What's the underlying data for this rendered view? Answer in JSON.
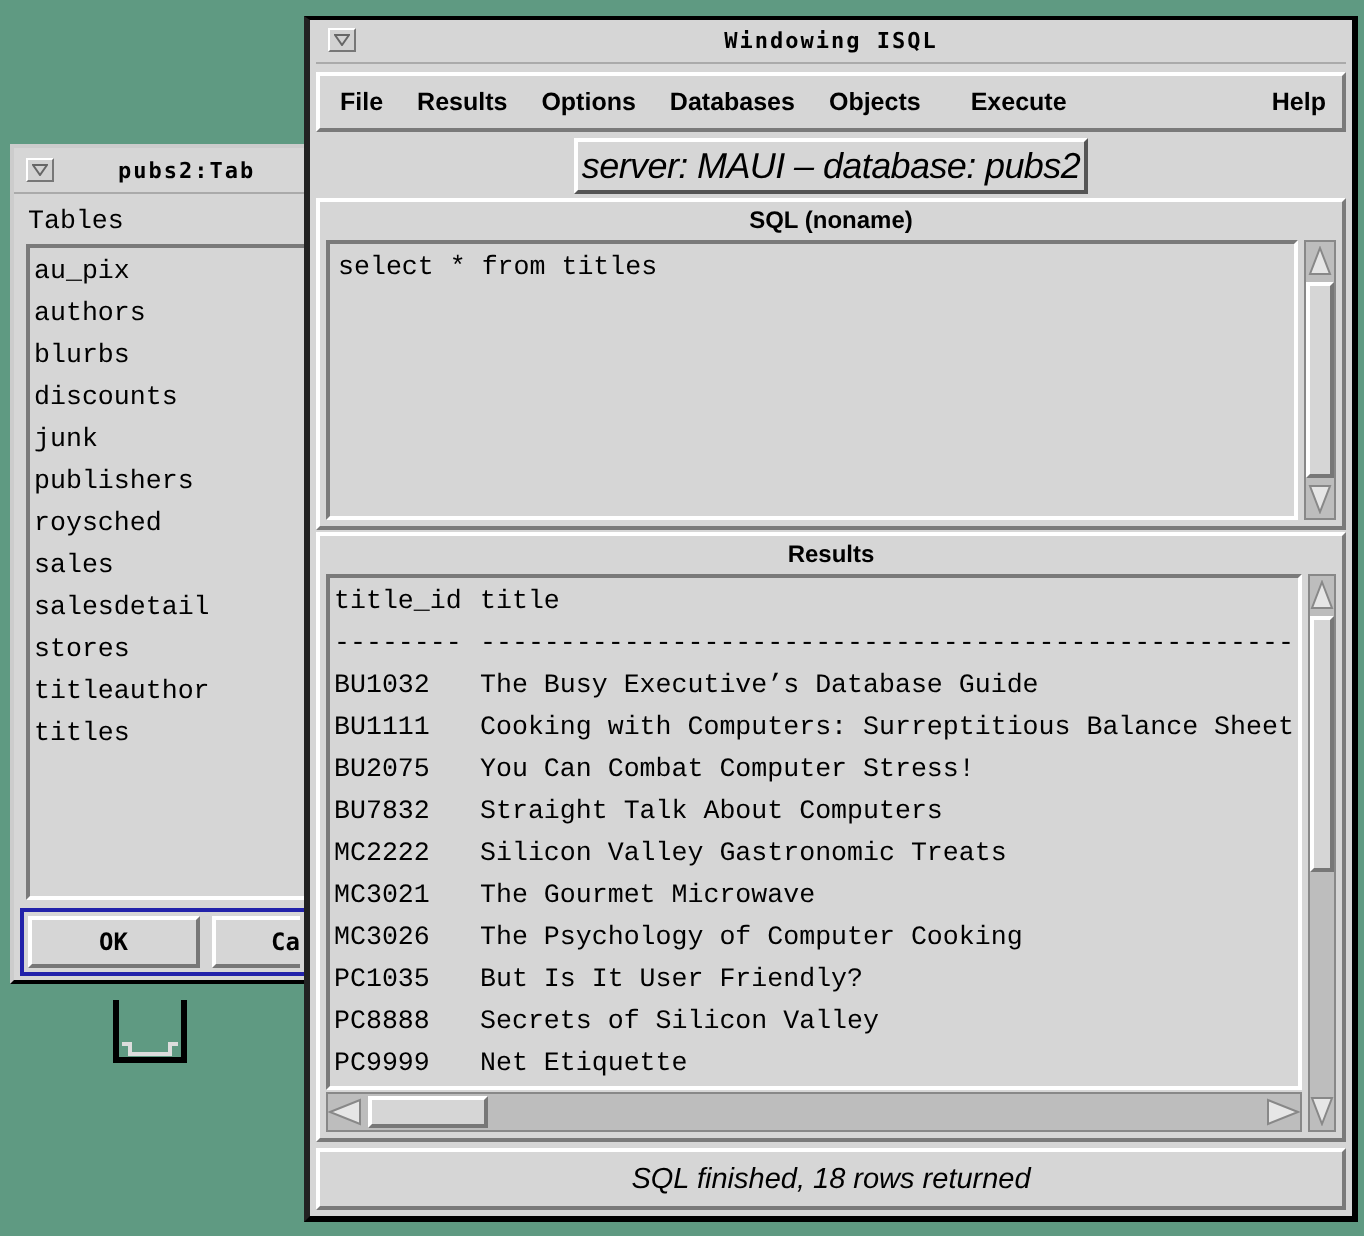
{
  "tables_window": {
    "title": "pubs2:Tab",
    "list_label": "Tables",
    "tables": [
      "au_pix",
      "authors",
      "blurbs",
      "discounts",
      "junk",
      "publishers",
      "roysched",
      "sales",
      "salesdetail",
      "stores",
      "titleauthor",
      "titles"
    ],
    "buttons": [
      "OK",
      "Ca"
    ]
  },
  "isql_window": {
    "title": "Windowing ISQL",
    "menu": [
      "File",
      "Results",
      "Options",
      "Databases",
      "Objects",
      "Execute",
      "Help"
    ],
    "connection": "server: MAUI – database: pubs2",
    "sql_title": "SQL (noname)",
    "sql_text": "select * from titles",
    "results_title": "Results",
    "results": {
      "header": [
        "title_id",
        "title"
      ],
      "rule": [
        "--------",
        "---------------------------------------------------"
      ],
      "rows": [
        [
          "BU1032",
          "The Busy Executive’s Database Guide"
        ],
        [
          "BU1111",
          "Cooking with Computers: Surreptitious Balance Sheet"
        ],
        [
          "BU2075",
          "You Can Combat Computer Stress!"
        ],
        [
          "BU7832",
          "Straight Talk About Computers"
        ],
        [
          "MC2222",
          "Silicon Valley Gastronomic Treats"
        ],
        [
          "MC3021",
          "The Gourmet Microwave"
        ],
        [
          "MC3026",
          "The Psychology of Computer Cooking"
        ],
        [
          "PC1035",
          "But Is It User Friendly?"
        ],
        [
          "PC8888",
          "Secrets of Silicon Valley"
        ],
        [
          "PC9999",
          "Net Etiquette"
        ]
      ]
    },
    "status": "SQL finished, 18 rows returned"
  }
}
